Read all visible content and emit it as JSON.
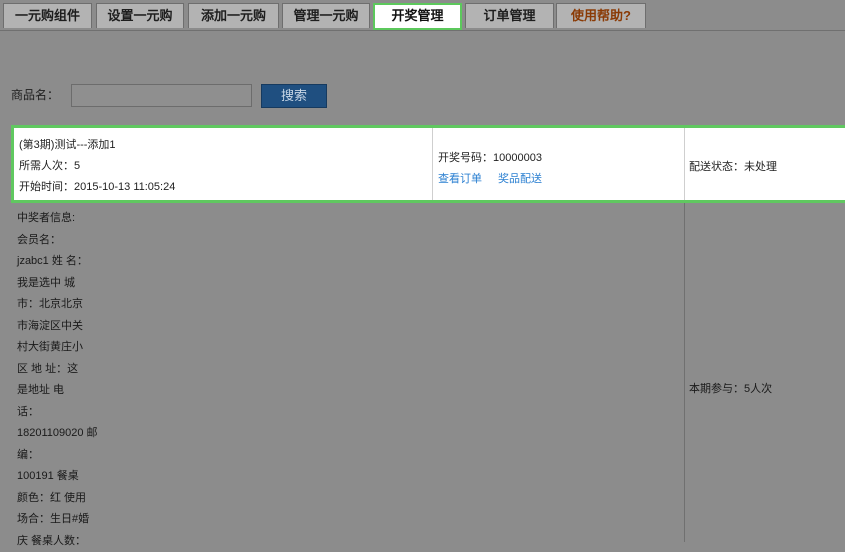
{
  "tabs": [
    {
      "label": "一元购组件"
    },
    {
      "label": "设置一元购"
    },
    {
      "label": "添加一元购"
    },
    {
      "label": "管理一元购"
    },
    {
      "label": "开奖管理"
    },
    {
      "label": "订单管理"
    },
    {
      "label": "使用帮助?"
    }
  ],
  "search": {
    "label": "商品名：",
    "placeholder": "",
    "button_label": "搜索"
  },
  "record": {
    "title": "(第3期)测试---添加1",
    "required_times": "所需人次：5",
    "start_time": "开始时间：2015-10-13 11:05:24",
    "lottery_number": "开奖号码：10000003",
    "view_order_link": "查看订单",
    "prize_delivery_link": "奖品配送",
    "delivery_status": "配送状态：未处理",
    "participants": "本期参与：5人次",
    "winner_lines": [
      "中奖者信息:",
      "会员名：",
      "jzabc1 姓  名：",
      "我是选中  城",
      "市：北京北京",
      "市海淀区中关",
      "村大街黄庄小",
      "区  地  址：这",
      "是地址  电",
      "话：",
      "18201109020 邮",
      "编：",
      "100191  餐桌",
      "颜色：红  使用",
      "场合：生日#婚",
      "庆  餐桌人数："
    ]
  }
}
